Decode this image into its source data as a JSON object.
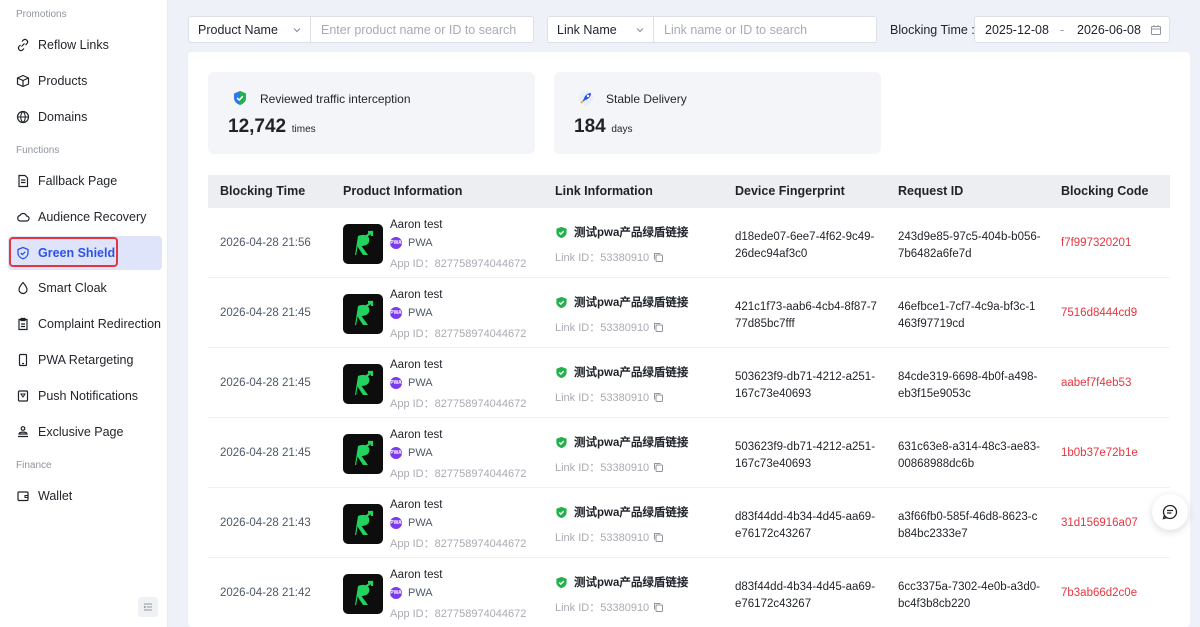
{
  "sidebar": {
    "sections": [
      {
        "title": "Promotions"
      },
      {
        "title": "Functions"
      },
      {
        "title": "Finance"
      }
    ],
    "items": [
      {
        "label": "Reflow Links",
        "icon": "link-icon"
      },
      {
        "label": "Products",
        "icon": "box-icon"
      },
      {
        "label": "Domains",
        "icon": "globe-icon"
      },
      {
        "label": "Fallback Page",
        "icon": "file-icon"
      },
      {
        "label": "Audience Recovery",
        "icon": "cloud-icon"
      },
      {
        "label": "Green Shield",
        "icon": "shield-icon",
        "active": true
      },
      {
        "label": "Smart Cloak",
        "icon": "drop-icon"
      },
      {
        "label": "Complaint Redirection",
        "icon": "clipboard-icon"
      },
      {
        "label": "PWA Retargeting",
        "icon": "phone-icon"
      },
      {
        "label": "Push Notifications",
        "icon": "bell-icon"
      },
      {
        "label": "Exclusive Page",
        "icon": "crown-icon"
      },
      {
        "label": "Wallet",
        "icon": "wallet-icon"
      }
    ]
  },
  "filters": {
    "product_select": "Product Name",
    "product_placeholder": "Enter product name or ID to search",
    "link_select": "Link Name",
    "link_placeholder": "Link name or ID to search",
    "time_label": "Blocking Time :",
    "date_start": "2025-12-08",
    "date_sep": "-",
    "date_end": "2026-06-08"
  },
  "stats": [
    {
      "title": "Reviewed traffic interception",
      "value": "12,742",
      "unit": "times",
      "icon": "shield-check-icon"
    },
    {
      "title": "Stable Delivery",
      "value": "184",
      "unit": "days",
      "icon": "rocket-icon"
    }
  ],
  "table": {
    "headers": [
      "Blocking Time",
      "Product Information",
      "Link Information",
      "Device Fingerprint",
      "Request ID",
      "Blocking Code"
    ],
    "rows": [
      {
        "time": "2026-04-28 21:56",
        "product": "Aaron test",
        "type": "PWA",
        "app_id": "App ID：827758974044672",
        "link": "测试pwa产品绿盾链接",
        "link_id": "Link ID：53380910",
        "fp1": "d18ede07-6ee7-4f62-9c49-",
        "fp2": "26dec94af3c0",
        "rid1": "243d9e85-97c5-404b-b056-",
        "rid2": "7b6482a6fe7d",
        "code": "f7f997320201"
      },
      {
        "time": "2026-04-28 21:45",
        "product": "Aaron test",
        "type": "PWA",
        "app_id": "App ID：827758974044672",
        "link": "测试pwa产品绿盾链接",
        "link_id": "Link ID：53380910",
        "fp1": "421c1f73-aab6-4cb4-8f87-7",
        "fp2": "77d85bc7fff",
        "rid1": "46efbce1-7cf7-4c9a-bf3c-1",
        "rid2": "463f97719cd",
        "code": "7516d8444cd9"
      },
      {
        "time": "2026-04-28 21:45",
        "product": "Aaron test",
        "type": "PWA",
        "app_id": "App ID：827758974044672",
        "link": "测试pwa产品绿盾链接",
        "link_id": "Link ID：53380910",
        "fp1": "503623f9-db71-4212-a251-",
        "fp2": "167c73e40693",
        "rid1": "84cde319-6698-4b0f-a498-",
        "rid2": "eb3f15e9053c",
        "code": "aabef7f4eb53"
      },
      {
        "time": "2026-04-28 21:45",
        "product": "Aaron test",
        "type": "PWA",
        "app_id": "App ID：827758974044672",
        "link": "测试pwa产品绿盾链接",
        "link_id": "Link ID：53380910",
        "fp1": "503623f9-db71-4212-a251-",
        "fp2": "167c73e40693",
        "rid1": "631c63e8-a314-48c3-ae83-",
        "rid2": "00868988dc6b",
        "code": "1b0b37e72b1e"
      },
      {
        "time": "2026-04-28 21:43",
        "product": "Aaron test",
        "type": "PWA",
        "app_id": "App ID：827758974044672",
        "link": "测试pwa产品绿盾链接",
        "link_id": "Link ID：53380910",
        "fp1": "d83f44dd-4b34-4d45-aa69-",
        "fp2": "e76172c43267",
        "rid1": "a3f66fb0-585f-46d8-8623-c",
        "rid2": "b84bc2333e7",
        "code": "31d156916a07"
      },
      {
        "time": "2026-04-28 21:42",
        "product": "Aaron test",
        "type": "PWA",
        "app_id": "App ID：827758974044672",
        "link": "测试pwa产品绿盾链接",
        "link_id": "Link ID：53380910",
        "fp1": "d83f44dd-4b34-4d45-aa69-",
        "fp2": "e76172c43267",
        "rid1": "6cc3375a-7302-4e0b-a3d0-",
        "rid2": "bc4f3b8cb220",
        "code": "7b3ab66d2c0e"
      }
    ]
  },
  "colors": {
    "accent": "#2b54e6",
    "danger": "#e5363f",
    "success": "#22b14c"
  }
}
